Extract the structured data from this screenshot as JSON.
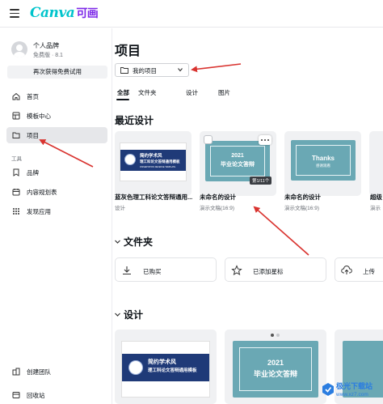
{
  "app": {
    "logo_text": "Canva",
    "logo_cn": "可画"
  },
  "sidebar": {
    "profile_name": "个人品牌",
    "profile_plan": "免费版 · 8.1",
    "trial_button": "再次获得免费试用",
    "items": [
      {
        "label": "首页",
        "icon": "home-icon"
      },
      {
        "label": "模板中心",
        "icon": "template-icon"
      },
      {
        "label": "项目",
        "icon": "folder-icon"
      }
    ],
    "tools_label": "工具",
    "tools": [
      {
        "label": "品牌",
        "icon": "brand-icon"
      },
      {
        "label": "内容规划表",
        "icon": "calendar-icon"
      },
      {
        "label": "发现应用",
        "icon": "apps-icon"
      }
    ],
    "bottom": [
      {
        "label": "创建团队",
        "icon": "team-icon"
      },
      {
        "label": "回收站",
        "icon": "trash-icon"
      }
    ]
  },
  "main": {
    "title": "项目",
    "project_select": "我的项目",
    "tabs": [
      "全部",
      "文件夹",
      "设计",
      "图片"
    ],
    "recent_heading": "最近设计",
    "recent": [
      {
        "title": "蓝灰色理工科论文答辩通用...",
        "subtitle": "设计",
        "thumb_title": "简约学术风",
        "thumb_sub": "理工科论文答辩通用模板",
        "thumb_note": "DISSERTATION DEFENSE TEMPLATE"
      },
      {
        "title": "未命名的设计",
        "subtitle": "演示文稿(16:9)",
        "thumb_year": "2021",
        "thumb_text": "毕业论文答辩",
        "badge": "第1/11个"
      },
      {
        "title": "未命名的设计",
        "subtitle": "演示文稿(16:9)",
        "thumb_text": "Thanks",
        "thumb_sub": "感谢观看"
      },
      {
        "title": "超级",
        "subtitle": "演示"
      }
    ],
    "folders_heading": "文件夹",
    "folders": [
      {
        "label": "已购买",
        "icon": "download-icon"
      },
      {
        "label": "已添加星标",
        "icon": "star-icon"
      },
      {
        "label": "上传",
        "icon": "upload-icon"
      }
    ],
    "designs_heading": "设计",
    "designs": [
      {
        "thumb_title": "简约学术风",
        "thumb_sub": "理工科论文答辩通用模板"
      },
      {
        "thumb_year": "2021",
        "thumb_text": "毕业论文答辩"
      }
    ]
  },
  "watermark": {
    "text": "极光下载站",
    "url": "www.xz7.com"
  },
  "colors": {
    "accent": "#00c4cc",
    "brand_purple": "#7d2ae8",
    "arrow": "#d9332f",
    "teal_thumb": "#6aa8b4",
    "navy_band": "#1f3a78"
  }
}
